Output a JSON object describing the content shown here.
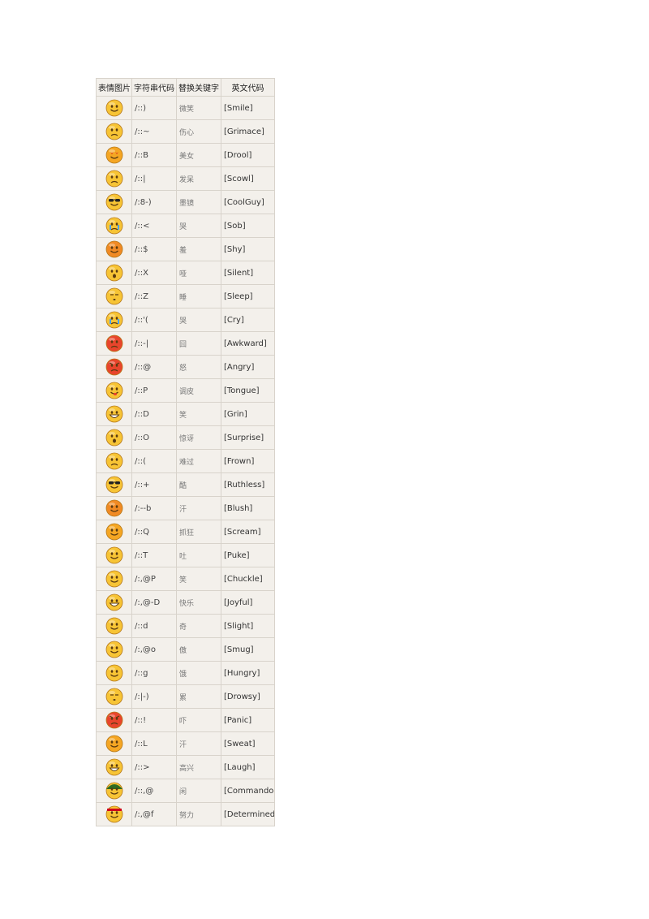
{
  "headers": [
    "表情图片",
    "字符串代码",
    "替换关键字",
    "英文代码"
  ],
  "rows": [
    {
      "code": "/::)",
      "keyword": "微笑",
      "english": "[Smile]",
      "face": "smile",
      "color": "#f7c435",
      "icon": "smile-icon"
    },
    {
      "code": "/::~",
      "keyword": "伤心",
      "english": "[Grimace]",
      "face": "grimace",
      "color": "#f7c435",
      "icon": "grimace-icon"
    },
    {
      "code": "/::B",
      "keyword": "美女",
      "english": "[Drool]",
      "face": "drool",
      "color": "#f5a623",
      "icon": "heart-eyes-icon"
    },
    {
      "code": "/::|",
      "keyword": "发呆",
      "english": "[Scowl]",
      "face": "scowl",
      "color": "#f7c435",
      "icon": "stare-icon"
    },
    {
      "code": "/:8-)",
      "keyword": "墨镜",
      "english": "[CoolGuy]",
      "face": "cool",
      "color": "#f7c435",
      "icon": "sunglasses-icon"
    },
    {
      "code": "/::<",
      "keyword": "哭",
      "english": "[Sob]",
      "face": "sob",
      "color": "#f7c435",
      "icon": "sob-icon"
    },
    {
      "code": "/::$",
      "keyword": "羞",
      "english": "[Shy]",
      "face": "shy",
      "color": "#f08a24",
      "icon": "shy-icon"
    },
    {
      "code": "/::X",
      "keyword": "哑",
      "english": "[Silent]",
      "face": "silent",
      "color": "#f7c435",
      "icon": "silent-icon"
    },
    {
      "code": "/::Z",
      "keyword": "睡",
      "english": "[Sleep]",
      "face": "sleep",
      "color": "#f7c435",
      "icon": "sleep-icon"
    },
    {
      "code": "/::'(",
      "keyword": "哭",
      "english": "[Cry]",
      "face": "cry",
      "color": "#f7c435",
      "icon": "cry-icon"
    },
    {
      "code": "/::-|",
      "keyword": "囧",
      "english": "[Awkward]",
      "face": "awkward",
      "color": "#e8452c",
      "icon": "awkward-icon"
    },
    {
      "code": "/::@",
      "keyword": "怒",
      "english": "[Angry]",
      "face": "angry",
      "color": "#e8452c",
      "icon": "angry-icon"
    },
    {
      "code": "/::P",
      "keyword": "调皮",
      "english": "[Tongue]",
      "face": "tongue",
      "color": "#f7c435",
      "icon": "tongue-icon"
    },
    {
      "code": "/::D",
      "keyword": "笑",
      "english": "[Grin]",
      "face": "grin",
      "color": "#f7c435",
      "icon": "grin-icon"
    },
    {
      "code": "/::O",
      "keyword": "惊讶",
      "english": "[Surprise]",
      "face": "surprise",
      "color": "#f7c435",
      "icon": "surprise-icon"
    },
    {
      "code": "/::(",
      "keyword": "难过",
      "english": "[Frown]",
      "face": "frown",
      "color": "#f7c435",
      "icon": "frown-icon"
    },
    {
      "code": "/::+",
      "keyword": "酷",
      "english": "[Ruthless]",
      "face": "ruthless",
      "color": "#f7c435",
      "icon": "shades-icon"
    },
    {
      "code": "/:--b",
      "keyword": "汗",
      "english": "[Blush]",
      "face": "blush",
      "color": "#f08a24",
      "icon": "blush-icon"
    },
    {
      "code": "/::Q",
      "keyword": "抓狂",
      "english": "[Scream]",
      "face": "scream",
      "color": "#f5a623",
      "icon": "scream-icon"
    },
    {
      "code": "/::T",
      "keyword": "吐",
      "english": "[Puke]",
      "face": "puke",
      "color": "#f7c435",
      "icon": "puke-icon"
    },
    {
      "code": "/:,@P",
      "keyword": "笑",
      "english": "[Chuckle]",
      "face": "chuckle",
      "color": "#f7c435",
      "icon": "chuckle-icon"
    },
    {
      "code": "/:,@-D",
      "keyword": "快乐",
      "english": "[Joyful]",
      "face": "joyful",
      "color": "#f7c435",
      "icon": "joyful-icon"
    },
    {
      "code": "/::d",
      "keyword": "奇",
      "english": "[Slight]",
      "face": "slight",
      "color": "#f7c435",
      "icon": "slight-icon"
    },
    {
      "code": "/:,@o",
      "keyword": "傲",
      "english": "[Smug]",
      "face": "smug",
      "color": "#f7c435",
      "icon": "smug-icon"
    },
    {
      "code": "/::g",
      "keyword": "饿",
      "english": "[Hungry]",
      "face": "hungry",
      "color": "#f7c435",
      "icon": "hungry-icon"
    },
    {
      "code": "/:|-)",
      "keyword": "累",
      "english": "[Drowsy]",
      "face": "drowsy",
      "color": "#f7c435",
      "icon": "drowsy-icon"
    },
    {
      "code": "/::!",
      "keyword": "吓",
      "english": "[Panic]",
      "face": "panic",
      "color": "#e8452c",
      "icon": "panic-icon"
    },
    {
      "code": "/::L",
      "keyword": "汗",
      "english": "[Sweat]",
      "face": "sweat",
      "color": "#f5a623",
      "icon": "sweat-icon"
    },
    {
      "code": "/::>",
      "keyword": "高兴",
      "english": "[Laugh]",
      "face": "laugh",
      "color": "#f7c435",
      "icon": "laugh-icon"
    },
    {
      "code": "/::,@",
      "keyword": "闲",
      "english": "[Commando]",
      "face": "commando",
      "color": "#f7c435",
      "icon": "army-helmet-icon"
    },
    {
      "code": "/:,@f",
      "keyword": "努力",
      "english": "[Determined]",
      "face": "determined",
      "color": "#f7c435",
      "icon": "headband-icon"
    }
  ]
}
